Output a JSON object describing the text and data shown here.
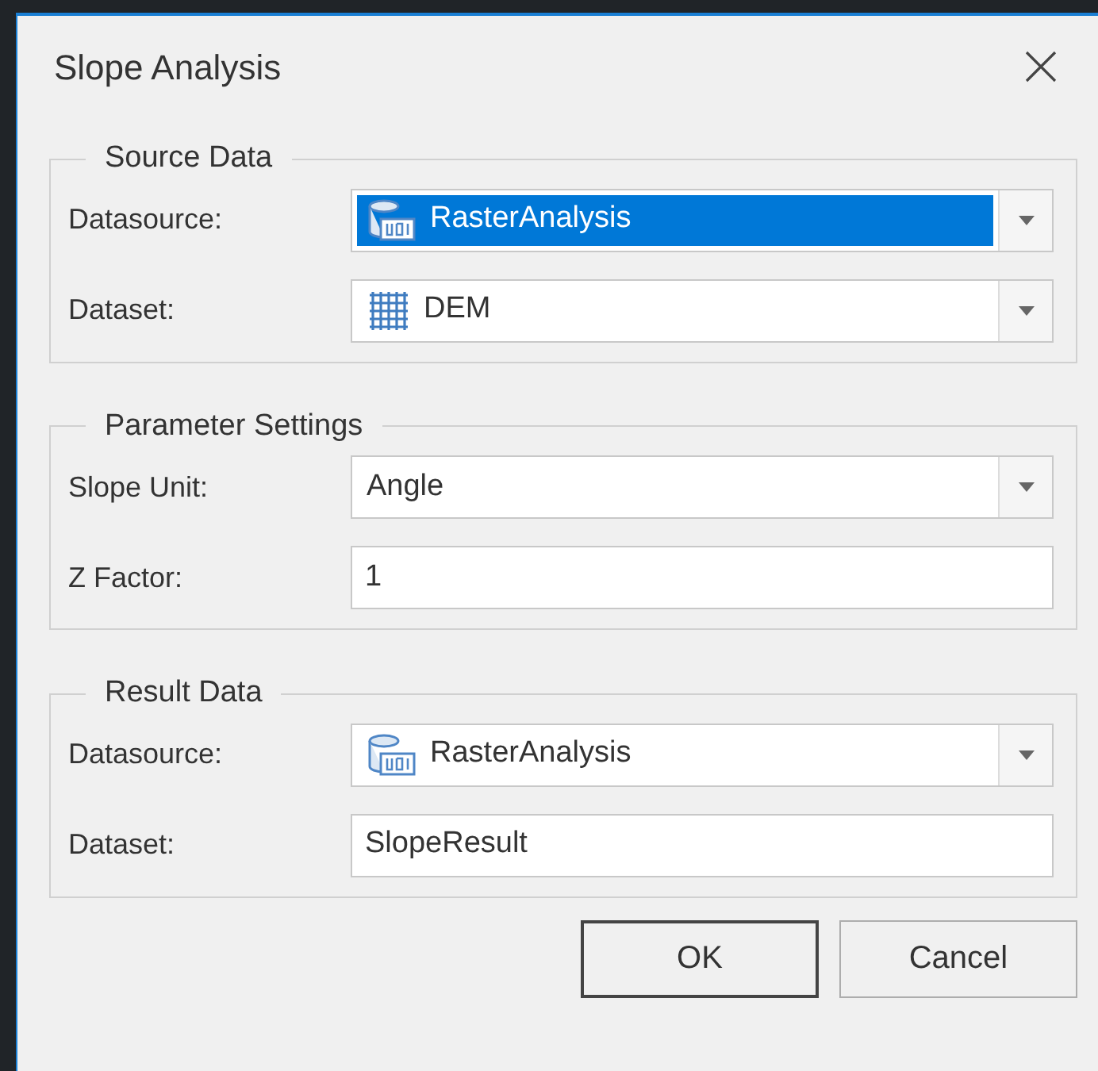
{
  "window": {
    "title": "Slope Analysis"
  },
  "groups": [
    {
      "title": "Source Data",
      "rows": [
        {
          "label": "Datasource:",
          "kind": "datasource",
          "value": "RasterAnalysis",
          "selected": true
        },
        {
          "label": "Dataset:",
          "kind": "dataset",
          "value": "DEM",
          "selected": false
        }
      ]
    },
    {
      "title": "Parameter Settings",
      "rows": [
        {
          "label": "Slope Unit:",
          "kind": "combo",
          "value": "Angle",
          "selected": false
        },
        {
          "label": "Z Factor:",
          "kind": "text",
          "value": "1"
        }
      ]
    },
    {
      "title": "Result Data",
      "rows": [
        {
          "label": "Datasource:",
          "kind": "datasource",
          "value": "RasterAnalysis",
          "selected": false
        },
        {
          "label": "Dataset:",
          "kind": "text",
          "value": "SlopeResult"
        }
      ]
    }
  ],
  "buttons": [
    {
      "label": "OK",
      "default": true
    },
    {
      "label": "Cancel",
      "default": false
    }
  ]
}
